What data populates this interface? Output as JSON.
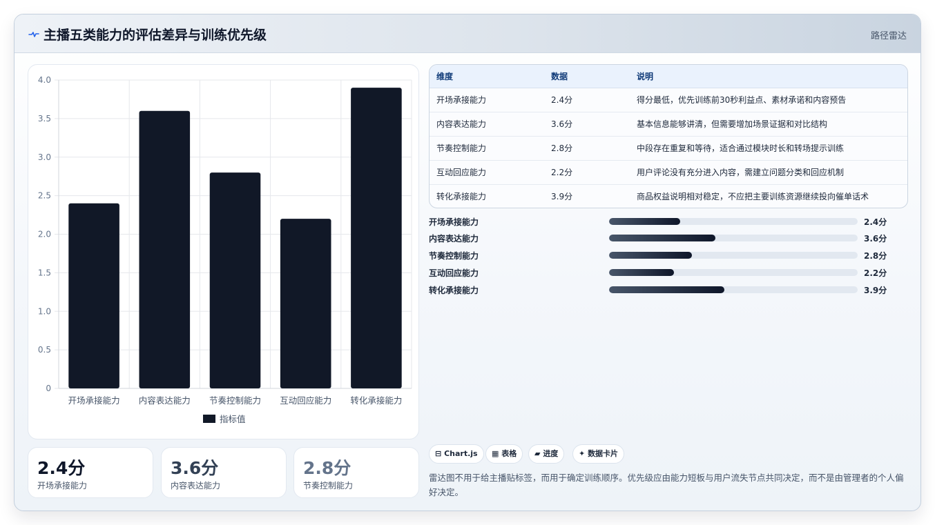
{
  "header": {
    "title": "主播五类能力的评估差异与训练优先级",
    "tag": "路径雷达"
  },
  "colors": {
    "bar": "#111827",
    "accent": "#0f172a",
    "grid": "#e5e7eb"
  },
  "chart_data": {
    "type": "bar",
    "categories": [
      "开场承接能力",
      "内容表达能力",
      "节奏控制能力",
      "互动回应能力",
      "转化承接能力"
    ],
    "series": [
      {
        "name": "指标值",
        "values": [
          2.4,
          3.6,
          2.8,
          2.2,
          3.9
        ]
      }
    ],
    "ylim": [
      0,
      4.0
    ],
    "yticks": [
      "0",
      "0.5",
      "1.0",
      "1.5",
      "2.0",
      "2.5",
      "3.0",
      "3.5",
      "4.0"
    ],
    "grid": true,
    "legend": "bottom"
  },
  "stats": [
    {
      "value": "2.4分",
      "label": "开场承接能力"
    },
    {
      "value": "3.6分",
      "label": "内容表达能力"
    },
    {
      "value": "2.8分",
      "label": "节奏控制能力"
    }
  ],
  "table": {
    "headers": [
      "维度",
      "数据",
      "说明"
    ],
    "rows": [
      [
        "开场承接能力",
        "2.4分",
        "得分最低，优先训练前30秒利益点、素材承诺和内容预告"
      ],
      [
        "内容表达能力",
        "3.6分",
        "基本信息能够讲清，但需要增加场景证据和对比结构"
      ],
      [
        "节奏控制能力",
        "2.8分",
        "中段存在重复和等待，适合通过模块时长和转场提示训练"
      ],
      [
        "互动回应能力",
        "2.2分",
        "用户评论没有充分进入内容，需建立问题分类和回应机制"
      ],
      [
        "转化承接能力",
        "3.9分",
        "商品权益说明相对稳定，不应把主要训练资源继续投向催单话术"
      ]
    ]
  },
  "progress": [
    {
      "label": "开场承接能力",
      "value": 2.4,
      "display": "2.4分"
    },
    {
      "label": "内容表达能力",
      "value": 3.6,
      "display": "3.6分"
    },
    {
      "label": "节奏控制能力",
      "value": 2.8,
      "display": "2.8分"
    },
    {
      "label": "互动回应能力",
      "value": 2.2,
      "display": "2.2分"
    },
    {
      "label": "转化承接能力",
      "value": 3.9,
      "display": "3.9分"
    }
  ],
  "progress_max": 8.4,
  "chips": [
    {
      "icon": "⊟",
      "label": "Chart.js"
    },
    {
      "icon": "▦",
      "label": "表格"
    },
    {
      "icon": "▰",
      "label": "进度"
    },
    {
      "icon": "✦",
      "label": "数据卡片"
    }
  ],
  "note": "雷达图不用于给主播贴标签，而用于确定训练顺序。优先级应由能力短板与用户流失节点共同决定，而不是由管理者的个人偏好决定。"
}
